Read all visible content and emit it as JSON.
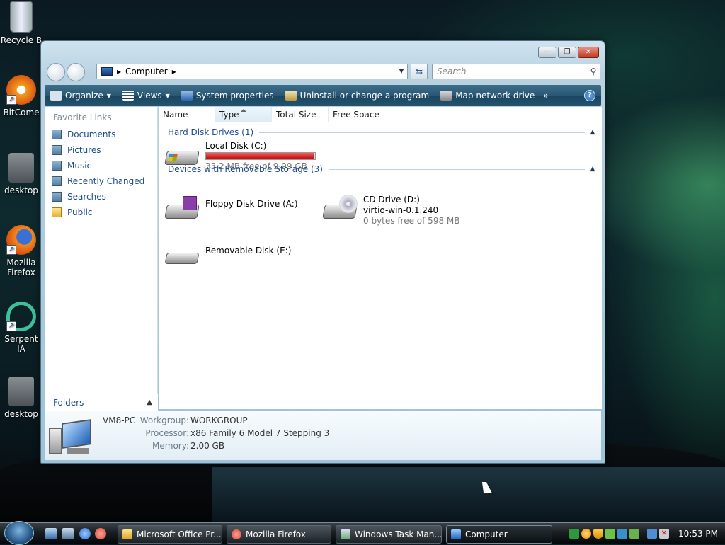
{
  "desktop": {
    "icons": [
      {
        "label": "Recycle B",
        "icon": "recycle-bin-icon"
      },
      {
        "label": "BitCome",
        "icon": "bitcomet-icon"
      },
      {
        "label": "desktop",
        "icon": "gear-file-icon"
      },
      {
        "label": "Mozilla Firefox",
        "icon": "firefox-icon"
      },
      {
        "label": "Serpent IA",
        "icon": "serpent-icon"
      },
      {
        "label": "desktop",
        "icon": "gear-file-icon"
      }
    ]
  },
  "window": {
    "title_buttons": {
      "minimize": "—",
      "maximize": "❐",
      "close": "✕"
    },
    "address": {
      "path": "Computer",
      "sep": "▸"
    },
    "search": {
      "placeholder": "Search"
    },
    "toolbar": {
      "organize": "Organize",
      "views": "Views",
      "system_properties": "System properties",
      "uninstall": "Uninstall or change a program",
      "map_drive": "Map network drive",
      "more": "»",
      "help": "?"
    },
    "nav": {
      "header": "Favorite Links",
      "items": [
        "Documents",
        "Pictures",
        "Music",
        "Recently Changed",
        "Searches",
        "Public"
      ],
      "folders": "Folders"
    },
    "columns": [
      "Name",
      "Type",
      "Total Size",
      "Free Space"
    ],
    "groups": {
      "hdd": "Hard Disk Drives (1)",
      "removable": "Devices with Removable Storage (3)"
    },
    "drives": {
      "c": {
        "name": "Local Disk (C:)",
        "free": "33.2 MB free of 9.99 GB",
        "used_fraction": 0.99
      },
      "a": {
        "name": "Floppy Disk Drive (A:)"
      },
      "d": {
        "name": "CD Drive (D:)",
        "label": "virtio-win-0.1.240",
        "free": "0 bytes free of 598 MB"
      },
      "e": {
        "name": "Removable Disk (E:)"
      }
    },
    "details": {
      "pc_name": "VM8-PC",
      "workgroup_label": "Workgroup:",
      "workgroup": "WORKGROUP",
      "processor_label": "Processor:",
      "processor": "x86 Family 6 Model 7 Stepping 3",
      "memory_label": "Memory:",
      "memory": "2.00 GB"
    }
  },
  "taskbar": {
    "buttons": [
      {
        "label": "Microsoft Office Pr...",
        "icon": "folder-icon"
      },
      {
        "label": "Mozilla Firefox",
        "icon": "firefox-icon"
      },
      {
        "label": "Windows Task Man...",
        "icon": "task-manager-icon"
      },
      {
        "label": "Computer",
        "icon": "computer-icon"
      }
    ],
    "clock": "10:53 PM"
  }
}
